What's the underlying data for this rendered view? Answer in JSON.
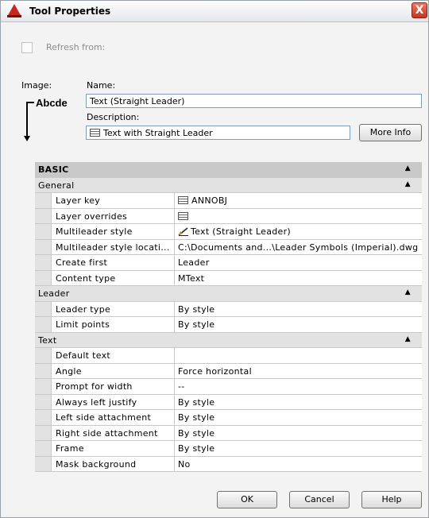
{
  "window": {
    "title": "Tool Properties",
    "close_glyph": "X"
  },
  "refresh": {
    "label": "Refresh from:",
    "checked": false
  },
  "image_label": "Image:",
  "preview": {
    "text": "Abcde"
  },
  "name": {
    "label": "Name:",
    "value": "Text (Straight Leader)"
  },
  "description": {
    "label": "Description:",
    "value": "Text with Straight Leader"
  },
  "more_info_label": "More Info",
  "grid": {
    "root": "BASIC",
    "sections": [
      {
        "title": "General",
        "rows": [
          {
            "name": "Layer key",
            "value": "ANNOBJ",
            "icon": "list-icon"
          },
          {
            "name": "Layer overrides",
            "value": "",
            "icon": "list-icon"
          },
          {
            "name": "Multileader style",
            "value": "Text (Straight Leader)",
            "icon": "multileader-icon"
          },
          {
            "name": "Multileader style locati...",
            "value": "C:\\Documents and...\\Leader Symbols (Imperial).dwg"
          },
          {
            "name": "Create first",
            "value": "Leader"
          },
          {
            "name": "Content type",
            "value": "MText"
          }
        ]
      },
      {
        "title": "Leader",
        "rows": [
          {
            "name": "Leader type",
            "value": "By style"
          },
          {
            "name": "Limit points",
            "value": "By style"
          }
        ]
      },
      {
        "title": "Text",
        "rows": [
          {
            "name": "Default text",
            "value": ""
          },
          {
            "name": "Angle",
            "value": "Force horizontal"
          },
          {
            "name": "Prompt for width",
            "value": "--"
          },
          {
            "name": "Always left justify",
            "value": "By style"
          },
          {
            "name": "Left side attachment",
            "value": "By style"
          },
          {
            "name": "Right side attachment",
            "value": "By style"
          },
          {
            "name": "Frame",
            "value": "By style"
          },
          {
            "name": "Mask background",
            "value": "No"
          }
        ]
      }
    ]
  },
  "buttons": {
    "ok": "OK",
    "cancel": "Cancel",
    "help": "Help"
  }
}
